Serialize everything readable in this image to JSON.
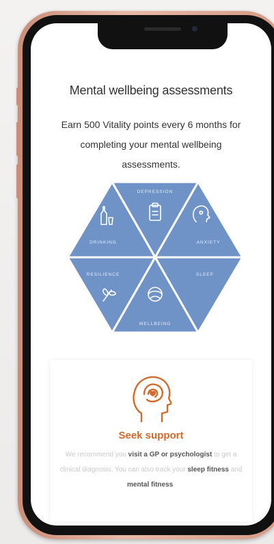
{
  "assessments": {
    "title": "Mental wellbeing assessments",
    "subtitle": "Earn  500  Vitality points every 6 months for completing your mental wellbeing assessments."
  },
  "hexagon": {
    "fill_color": "#6f93c7",
    "segments": [
      {
        "label": "DEPRESSION",
        "icon": "clipboard-icon"
      },
      {
        "label": "ANXIETY",
        "icon": "anxious-face-icon"
      },
      {
        "label": "SLEEP",
        "icon": "sleep-jar-icon"
      },
      {
        "label": "WELLBEING",
        "icon": "wellbeing-sphere-icon"
      },
      {
        "label": "RESILIENCE",
        "icon": "resilience-flower-icon"
      },
      {
        "label": "DRINKING",
        "icon": "bottle-glass-icon"
      }
    ]
  },
  "support": {
    "title": "Seek support",
    "icon": "head-heart-icon",
    "accent_color": "#d26a2a",
    "body": {
      "p1": "We recommend you ",
      "b1": "visit a GP or psychologist",
      "p2": " to get a clinical diagnosis. You can also track your ",
      "b2": "sleep fitness",
      "p3": " and ",
      "b3": "mental fitness",
      "p4": "."
    }
  }
}
